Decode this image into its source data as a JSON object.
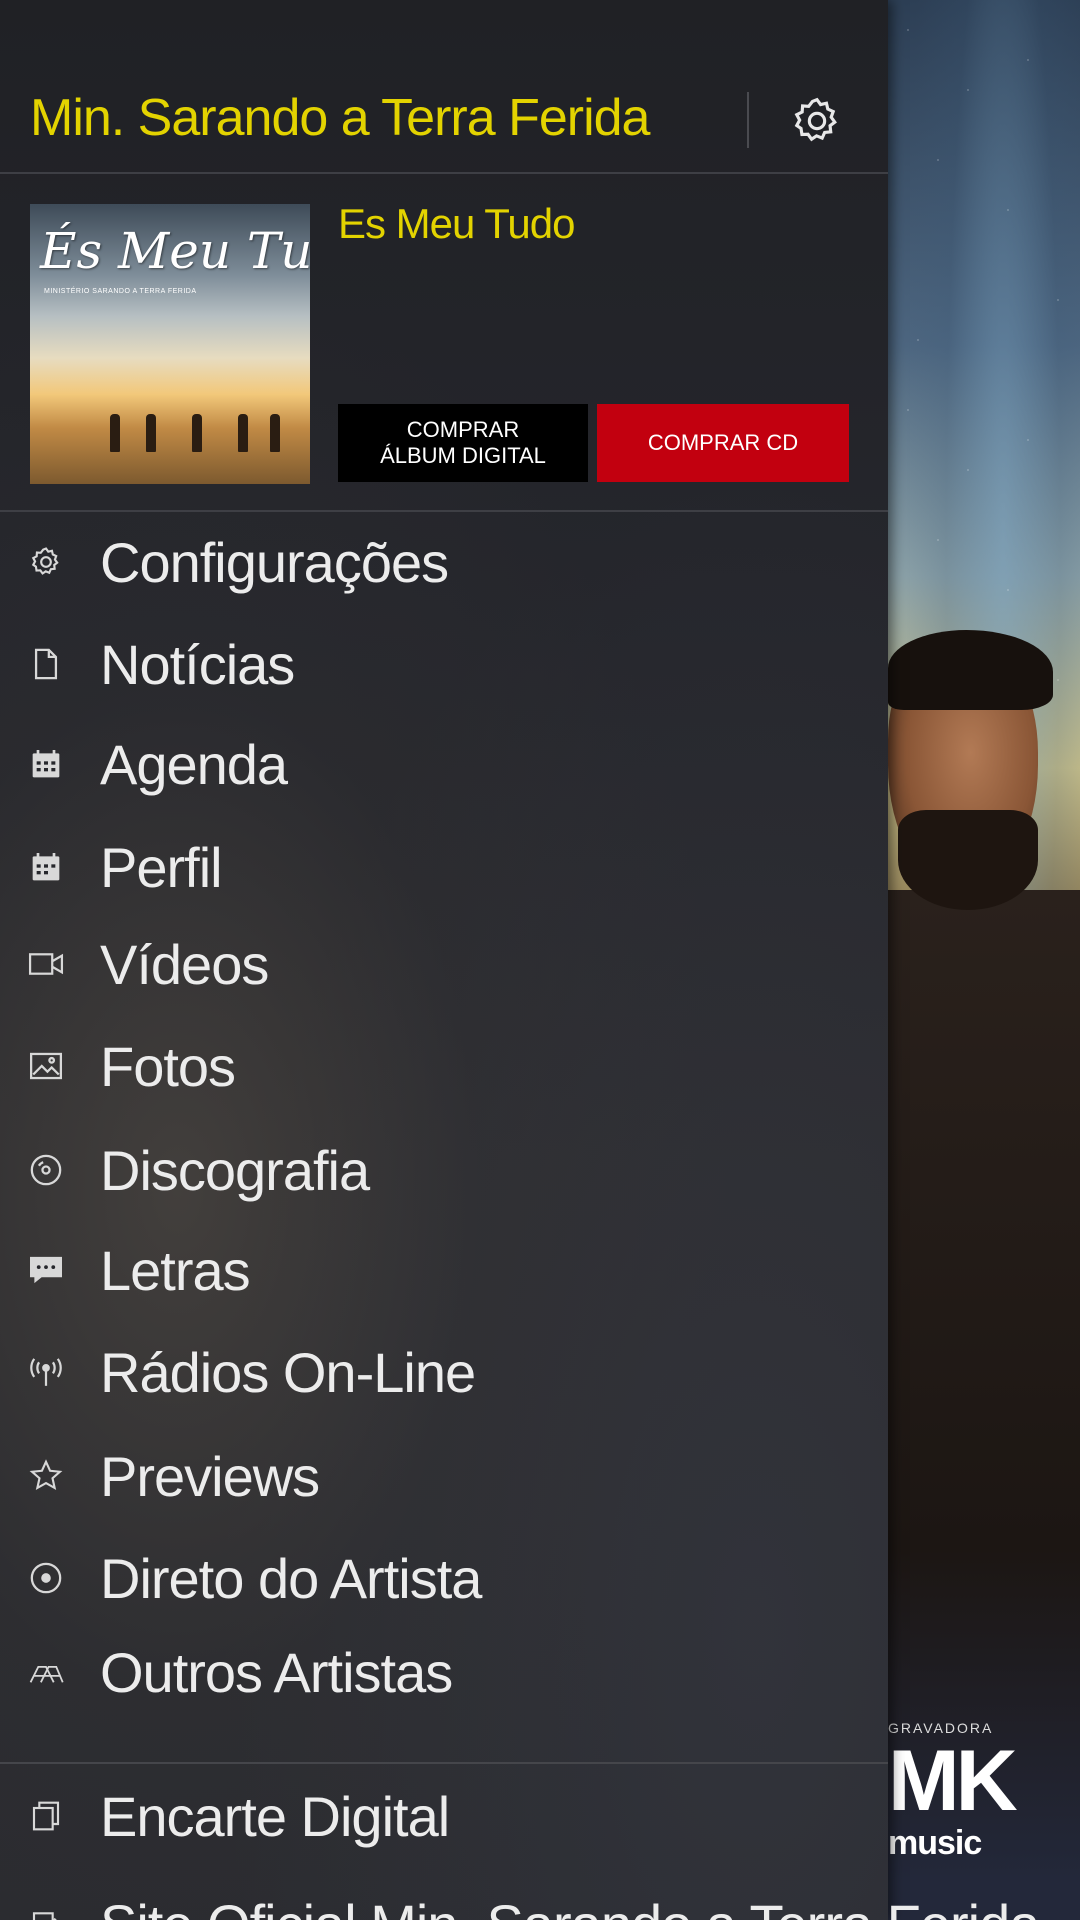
{
  "header": {
    "artist_title": "Min. Sarando a Terra Ferida",
    "settings_icon": "gear-icon"
  },
  "album": {
    "cover_title": "És Meu Tudo",
    "cover_subtitle": "MINISTÉRIO SARANDO A TERRA FERIDA",
    "name": "Es Meu Tudo",
    "buy_digital_line1": "COMPRAR",
    "buy_digital_line2": "ÁLBUM DIGITAL",
    "buy_cd": "COMPRAR CD",
    "buy_cd_color": "#c2000f"
  },
  "menu": [
    {
      "label": "Configurações",
      "icon": "gear-icon"
    },
    {
      "label": "Notícias",
      "icon": "document-icon"
    },
    {
      "label": "Agenda",
      "icon": "calendar-icon"
    },
    {
      "label": "Perfil",
      "icon": "profile-calendar-icon"
    },
    {
      "label": "Vídeos",
      "icon": "video-camera-icon"
    },
    {
      "label": "Fotos",
      "icon": "photo-icon"
    },
    {
      "label": "Discografia",
      "icon": "disc-icon"
    },
    {
      "label": "Letras",
      "icon": "chat-bubble-icon"
    },
    {
      "label": "Rádios On-Line",
      "icon": "radio-antenna-icon"
    },
    {
      "label": "Previews",
      "icon": "star-icon"
    },
    {
      "label": "Direto do Artista",
      "icon": "target-circle-icon"
    },
    {
      "label": "Outros Artistas",
      "icon": "people-icon"
    }
  ],
  "extras": [
    {
      "label": "Encarte Digital",
      "icon": "booklet-icon"
    },
    {
      "label": "Site Oficial Min. Sarando a Terra Ferida",
      "icon": "external-link-icon"
    }
  ],
  "logo": {
    "small": "GRAVADORA",
    "big": "MK",
    "music": "music"
  },
  "colors": {
    "accent": "#e3d300",
    "drawer_bg": "#25262c"
  }
}
